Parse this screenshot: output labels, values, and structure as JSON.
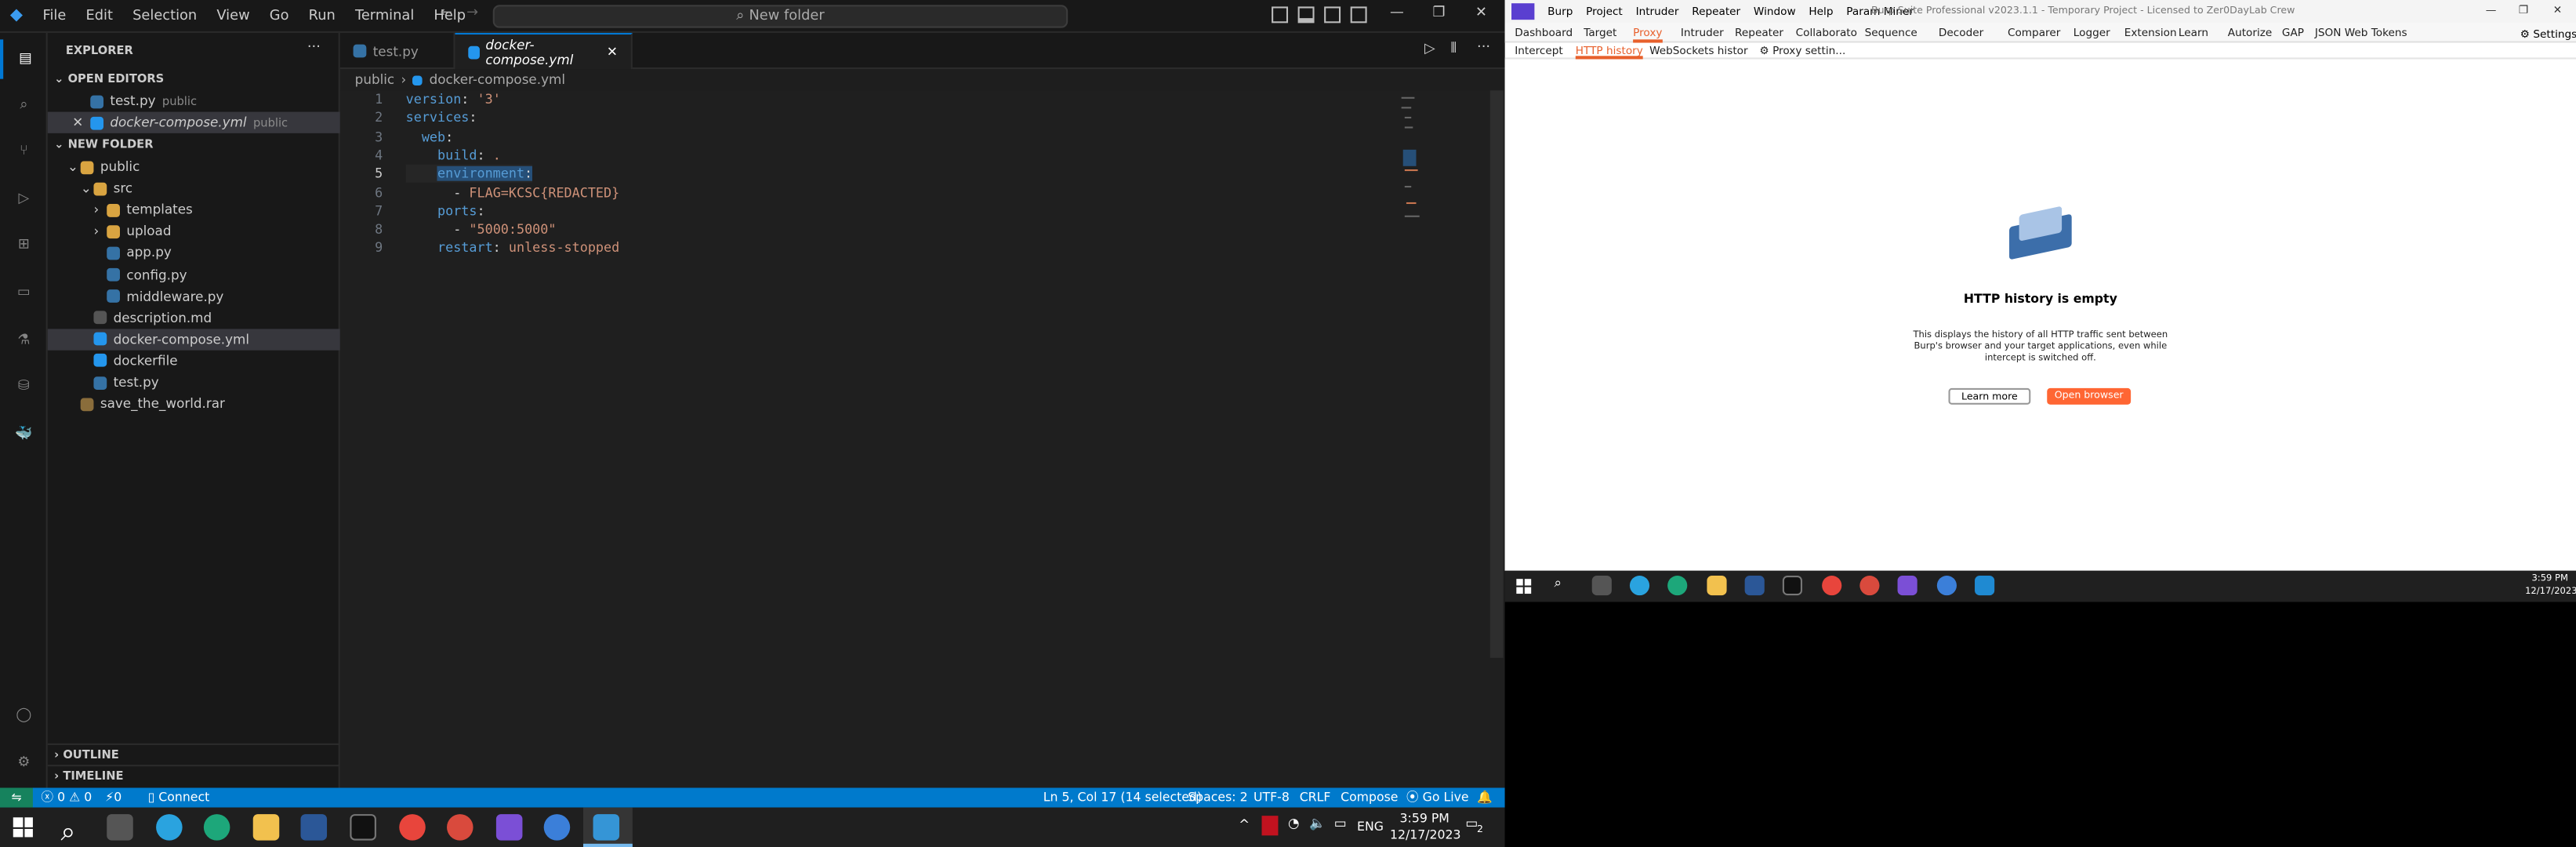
{
  "vscode": {
    "menu": [
      "File",
      "Edit",
      "Selection",
      "View",
      "Go",
      "Run",
      "Terminal",
      "Help"
    ],
    "command_center": "New folder",
    "explorer_title": "EXPLORER",
    "open_editors_header": "OPEN EDITORS",
    "open_editors": [
      {
        "name": "test.py",
        "desc": "public"
      },
      {
        "name": "docker-compose.yml",
        "desc": "public"
      }
    ],
    "folder_header": "NEW FOLDER",
    "tree": [
      {
        "name": "public",
        "indent": 1,
        "type": "folder-open"
      },
      {
        "name": "src",
        "indent": 2,
        "type": "folder-open"
      },
      {
        "name": "templates",
        "indent": 3,
        "type": "folder"
      },
      {
        "name": "upload",
        "indent": 3,
        "type": "folder"
      },
      {
        "name": "app.py",
        "indent": 3,
        "type": "py"
      },
      {
        "name": "config.py",
        "indent": 3,
        "type": "py"
      },
      {
        "name": "middleware.py",
        "indent": 3,
        "type": "py"
      },
      {
        "name": "description.md",
        "indent": 2,
        "type": "md"
      },
      {
        "name": "docker-compose.yml",
        "indent": 2,
        "type": "docker",
        "selected": true
      },
      {
        "name": "dockerfile",
        "indent": 2,
        "type": "docker"
      },
      {
        "name": "test.py",
        "indent": 2,
        "type": "py"
      },
      {
        "name": "save_the_world.rar",
        "indent": 1,
        "type": "rar"
      }
    ],
    "outline": "OUTLINE",
    "timeline": "TIMELINE",
    "tabs": [
      {
        "name": "test.py",
        "active": false
      },
      {
        "name": "docker-compose.yml",
        "active": true
      }
    ],
    "breadcrumb": [
      "public",
      "docker-compose.yml"
    ],
    "code": [
      "version: '3'",
      "services:",
      "  web:",
      "    build: .",
      "    environment:",
      "      - FLAG=KCSC{REDACTED}",
      "    ports:",
      "      - \"5000:5000\"",
      "    restart: unless-stopped"
    ],
    "status": {
      "errors": "0",
      "warnings": "0",
      "ports": "0",
      "connect": "Connect",
      "position": "Ln 5, Col 17 (14 selected)",
      "spaces": "Spaces: 2",
      "encoding": "UTF-8",
      "eol": "CRLF",
      "language": "Compose",
      "golive": "Go Live"
    }
  },
  "taskbar": {
    "time": "3:59 PM",
    "date": "12/17/2023",
    "lang": "ENG",
    "badge": "2"
  },
  "burp": {
    "menu": [
      "Burp",
      "Project",
      "Intruder",
      "Repeater",
      "Window",
      "Help",
      "Param Miner"
    ],
    "title": "Burp Suite Professional v2023.1.1 - Temporary Project - Licensed to Zer0DayLab Crew",
    "tabs": [
      "Dashboard",
      "Target",
      "Proxy",
      "Intruder",
      "Repeater",
      "Collaborato",
      "Sequence",
      "Decoder",
      "Comparer",
      "Logger",
      "Extension",
      "Learn",
      "Autorize",
      "GAP",
      "JSON Web Tokens"
    ],
    "settings": "Settings",
    "subtabs": [
      "Intercept",
      "HTTP history",
      "WebSockets histor",
      "Proxy settin..."
    ],
    "empty_title": "HTTP history is empty",
    "empty_desc": [
      "This displays the history of all HTTP traffic sent between",
      "Burp's browser and your target applications, even while",
      "intercept is switched off."
    ],
    "learn_more": "Learn more",
    "open_browser": "Open browser"
  },
  "taskbar2": {
    "time": "3:59 PM",
    "date": "12/17/2023"
  }
}
